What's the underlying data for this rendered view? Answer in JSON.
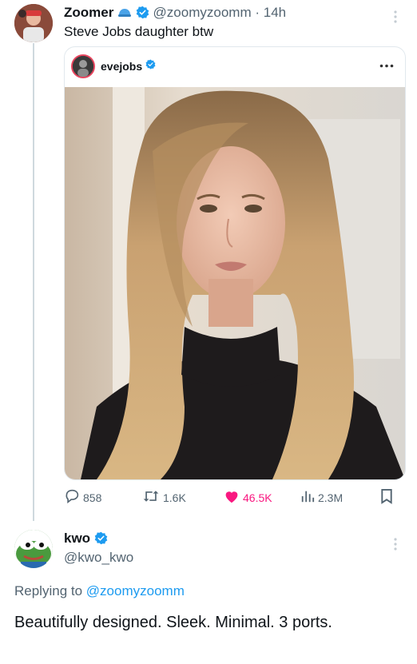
{
  "tweet": {
    "author_name": "Zoomer",
    "author_handle": "@zoomyzoomm",
    "separator": "·",
    "time": "14h",
    "text": "Steve Jobs daughter btw",
    "embed": {
      "username": "evejobs"
    },
    "stats": {
      "replies": "858",
      "retweets": "1.6K",
      "likes": "46.5K",
      "views": "2.3M"
    }
  },
  "reply": {
    "author_name": "kwo",
    "author_handle": "@kwo_kwo",
    "replying_prefix": "Replying to",
    "replying_to": "@zoomyzoomm",
    "text": "Beautifully designed. Sleek. Minimal. 3 ports."
  },
  "colors": {
    "verified": "#1d9bf0",
    "like": "#f91880",
    "secondary_text": "#536471",
    "link": "#1d9bf0"
  },
  "icons": [
    "reply-icon",
    "retweet-icon",
    "heart-icon",
    "views-icon",
    "bookmark-icon",
    "verified-icon",
    "more-icon"
  ]
}
